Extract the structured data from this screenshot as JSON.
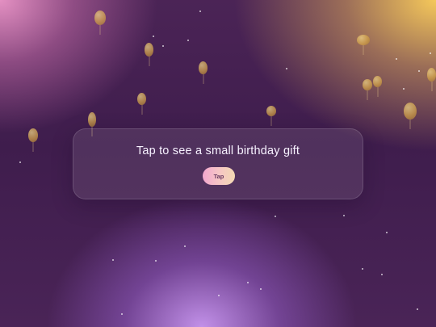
{
  "card": {
    "message": "Tap to see a small birthday gift",
    "button_label": "Tap"
  },
  "colors": {
    "top_left_glow": "#ec96c8",
    "top_right_glow": "#f5c85a",
    "bottom_glow": "#c896f0",
    "background": "#3f1d4d",
    "balloon": "#d6a64a",
    "button_gradient_start": "#f3a7cf",
    "button_gradient_end": "#f3d9b3"
  }
}
